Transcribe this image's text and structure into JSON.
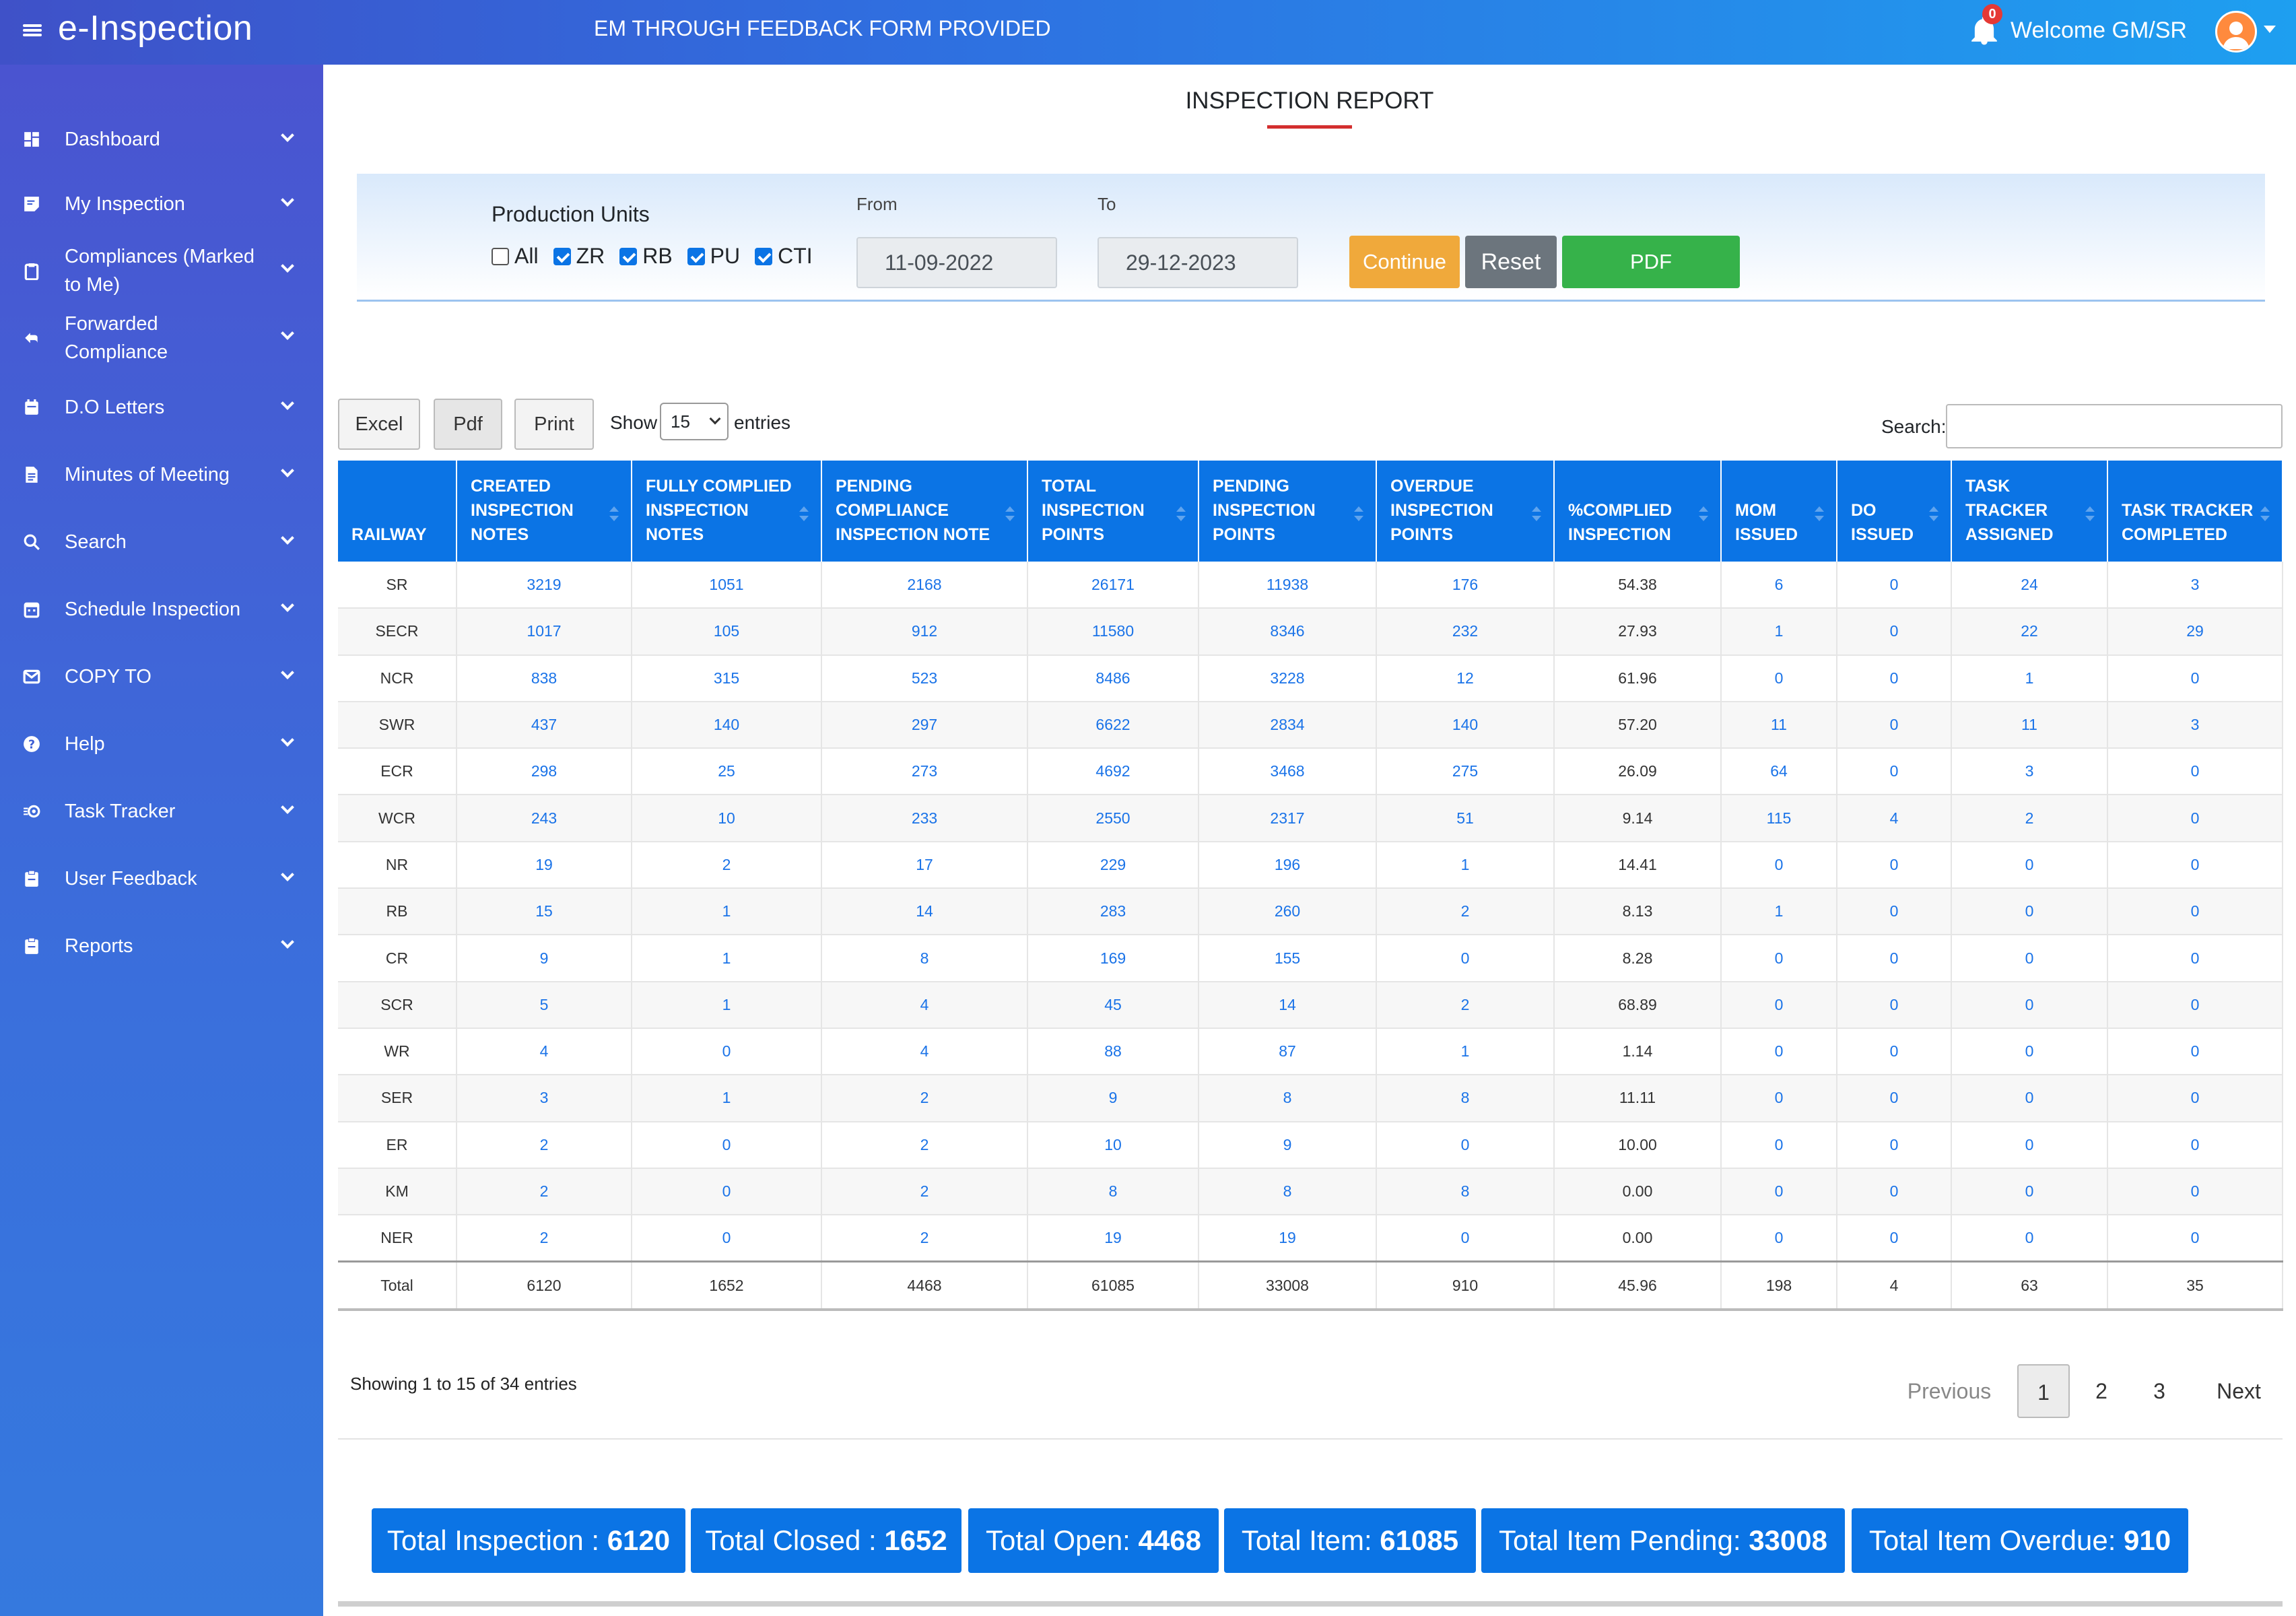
{
  "app": {
    "title": "e-Inspection",
    "marquee": "EM THROUGH FEEDBACK FORM PROVIDED",
    "notification_count": "0",
    "welcome": "Welcome  GM/SR"
  },
  "sidebar": {
    "items": [
      {
        "label": "Dashboard",
        "icon": "dashboard-icon"
      },
      {
        "label": "My Inspection",
        "icon": "inspection-icon"
      },
      {
        "label": "Compliances (Marked to Me)",
        "icon": "clipboard-icon"
      },
      {
        "label": "Forwarded Compliance",
        "icon": "reply-icon"
      },
      {
        "label": "D.O Letters",
        "icon": "calendar-icon"
      },
      {
        "label": "Minutes of Meeting",
        "icon": "document-icon"
      },
      {
        "label": "Search",
        "icon": "search-icon"
      },
      {
        "label": "Schedule Inspection",
        "icon": "calendar-icon"
      },
      {
        "label": "COPY TO",
        "icon": "mail-icon"
      },
      {
        "label": "Help",
        "icon": "help-icon"
      },
      {
        "label": "Task Tracker",
        "icon": "task-icon"
      },
      {
        "label": "User Feedback",
        "icon": "clipboard-icon"
      },
      {
        "label": "Reports",
        "icon": "clipboard-icon"
      }
    ]
  },
  "page": {
    "title": "INSPECTION REPORT"
  },
  "filters": {
    "production_units_label": "Production Units",
    "units": [
      {
        "label": "All",
        "checked": false
      },
      {
        "label": "ZR",
        "checked": true
      },
      {
        "label": "RB",
        "checked": true
      },
      {
        "label": "PU",
        "checked": true
      },
      {
        "label": "CTI",
        "checked": true
      }
    ],
    "from_label": "From",
    "from_value": "11-09-2022",
    "to_label": "To",
    "to_value": "29-12-2023",
    "continue_label": "Continue",
    "reset_label": "Reset",
    "pdf_label": "PDF"
  },
  "toolbar": {
    "excel": "Excel",
    "pdf": "Pdf",
    "print": "Print",
    "show": "Show",
    "page_size": "15",
    "entries": "entries",
    "search_label": "Search:"
  },
  "table": {
    "headers": [
      "RAILWAY",
      "CREATED INSPECTION NOTES",
      "FULLY COMPLIED INSPECTION NOTES",
      "PENDING COMPLIANCE INSPECTION NOTE",
      "TOTAL INSPECTION POINTS",
      "PENDING INSPECTION POINTS",
      "OVERDUE INSPECTION POINTS",
      "%COMPLIED INSPECTION",
      "MOM ISSUED",
      "DO ISSUED",
      "TASK TRACKER ASSIGNED",
      "TASK TRACKER COMPLETED"
    ],
    "rows": [
      [
        "SR",
        "3219",
        "1051",
        "2168",
        "26171",
        "11938",
        "176",
        "54.38",
        "6",
        "0",
        "24",
        "3"
      ],
      [
        "SECR",
        "1017",
        "105",
        "912",
        "11580",
        "8346",
        "232",
        "27.93",
        "1",
        "0",
        "22",
        "29"
      ],
      [
        "NCR",
        "838",
        "315",
        "523",
        "8486",
        "3228",
        "12",
        "61.96",
        "0",
        "0",
        "1",
        "0"
      ],
      [
        "SWR",
        "437",
        "140",
        "297",
        "6622",
        "2834",
        "140",
        "57.20",
        "11",
        "0",
        "11",
        "3"
      ],
      [
        "ECR",
        "298",
        "25",
        "273",
        "4692",
        "3468",
        "275",
        "26.09",
        "64",
        "0",
        "3",
        "0"
      ],
      [
        "WCR",
        "243",
        "10",
        "233",
        "2550",
        "2317",
        "51",
        "9.14",
        "115",
        "4",
        "2",
        "0"
      ],
      [
        "NR",
        "19",
        "2",
        "17",
        "229",
        "196",
        "1",
        "14.41",
        "0",
        "0",
        "0",
        "0"
      ],
      [
        "RB",
        "15",
        "1",
        "14",
        "283",
        "260",
        "2",
        "8.13",
        "1",
        "0",
        "0",
        "0"
      ],
      [
        "CR",
        "9",
        "1",
        "8",
        "169",
        "155",
        "0",
        "8.28",
        "0",
        "0",
        "0",
        "0"
      ],
      [
        "SCR",
        "5",
        "1",
        "4",
        "45",
        "14",
        "2",
        "68.89",
        "0",
        "0",
        "0",
        "0"
      ],
      [
        "WR",
        "4",
        "0",
        "4",
        "88",
        "87",
        "1",
        "1.14",
        "0",
        "0",
        "0",
        "0"
      ],
      [
        "SER",
        "3",
        "1",
        "2",
        "9",
        "8",
        "8",
        "11.11",
        "0",
        "0",
        "0",
        "0"
      ],
      [
        "ER",
        "2",
        "0",
        "2",
        "10",
        "9",
        "0",
        "10.00",
        "0",
        "0",
        "0",
        "0"
      ],
      [
        "KM",
        "2",
        "0",
        "2",
        "8",
        "8",
        "8",
        "0.00",
        "0",
        "0",
        "0",
        "0"
      ],
      [
        "NER",
        "2",
        "0",
        "2",
        "19",
        "19",
        "0",
        "0.00",
        "0",
        "0",
        "0",
        "0"
      ]
    ],
    "footer": [
      "Total",
      "6120",
      "1652",
      "4468",
      "61085",
      "33008",
      "910",
      "45.96",
      "198",
      "4",
      "63",
      "35"
    ]
  },
  "pagination": {
    "showing": "Showing 1 to 15 of 34 entries",
    "previous": "Previous",
    "pages": [
      "1",
      "2",
      "3"
    ],
    "next": "Next"
  },
  "summary": [
    {
      "label": "Total Inspection : ",
      "value": "6120"
    },
    {
      "label": "Total Closed : ",
      "value": "1652"
    },
    {
      "label": "Total Open: ",
      "value": "4468"
    },
    {
      "label": "Total Item: ",
      "value": "61085"
    },
    {
      "label": "Total Item Pending: ",
      "value": "33008"
    },
    {
      "label": "Total Item Overdue: ",
      "value": "910"
    }
  ],
  "colors": {
    "primary": "#0b74e5",
    "continue": "#f0a93b",
    "reset": "#6c757d",
    "pdf": "#36b24a",
    "accent_red": "#d32f2f"
  }
}
